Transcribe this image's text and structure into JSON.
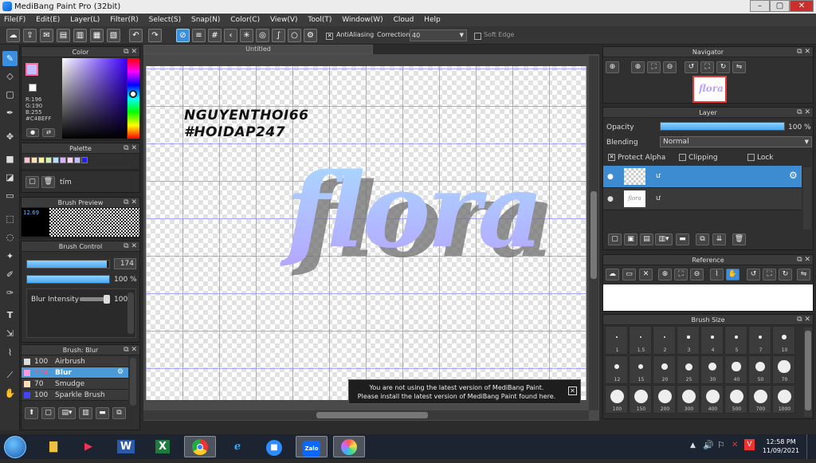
{
  "window": {
    "title": "MediBang Paint Pro (32bit)",
    "min": "–",
    "max": "▢",
    "close": "✕"
  },
  "menu": [
    "File(F)",
    "Edit(E)",
    "Layer(L)",
    "Filter(R)",
    "Select(S)",
    "Snap(N)",
    "Color(C)",
    "View(V)",
    "Tool(T)",
    "Window(W)",
    "Cloud",
    "Help"
  ],
  "toolbar": {
    "antialiasing_label": "AntiAliasing",
    "antialiasing_checked": true,
    "correction_label": "Correction",
    "correction_value": "40",
    "softedge_label": "Soft Edge",
    "softedge_checked": false
  },
  "color_panel": {
    "title": "Color",
    "r": "R:196",
    "g": "G:190",
    "b": "B:255",
    "hex": "#C4BEFF",
    "main_color": "#C4BEFF"
  },
  "palette": {
    "title": "Palette",
    "name": "tím",
    "swatches": [
      "#ffc0d0",
      "#ffe0b0",
      "#fff0a0",
      "#d0f0b0",
      "#b0e0ff",
      "#e0b0ff",
      "#ffd0f0",
      "#c4beff",
      "#2020ff"
    ]
  },
  "brush_preview": {
    "title": "Brush Preview",
    "size": "12.69"
  },
  "brush_control": {
    "title": "Brush Control",
    "size_value": "174",
    "size_fraction": 0.97,
    "opacity_value": "100 %",
    "opacity_fraction": 1.0,
    "blur_label": "Blur Intensity",
    "blur_value": "100"
  },
  "brush_list": {
    "title": "Brush: Blur",
    "items": [
      {
        "size": "100",
        "name": "Airbrush",
        "color": "#dddddd"
      },
      {
        "size": "174",
        "name": "Blur",
        "color": "#ff99dd",
        "selected": true
      },
      {
        "size": "70",
        "name": "Smudge",
        "color": "#ffddbb"
      },
      {
        "size": "100",
        "name": "Sparkle Brush",
        "color": "#4444ff"
      }
    ]
  },
  "canvas": {
    "tab": "Untitled",
    "watermark_line1": "NGUYENTHOI66",
    "watermark_line2": "#HOIDAP247",
    "art_text": "flora"
  },
  "notification": {
    "line1": "You are not using the latest version of MediBang Paint.",
    "line2": "Please install the latest version of MediBang Paint found here.",
    "close": "✕"
  },
  "navigator": {
    "title": "Navigator",
    "thumb_text": "flora"
  },
  "layer_panel": {
    "title": "Layer",
    "opacity_label": "Opacity",
    "opacity_value": "100 %",
    "opacity_fraction": 1.0,
    "blending_label": "Blending",
    "blending_value": "Normal",
    "protect_alpha": "Protect Alpha",
    "protect_alpha_checked": true,
    "clipping": "Clipping",
    "clipping_checked": false,
    "lock": "Lock",
    "lock_checked": false,
    "layers": [
      {
        "name": "ư",
        "selected": true
      },
      {
        "name": "ư",
        "selected": false
      }
    ]
  },
  "reference": {
    "title": "Reference"
  },
  "brush_size": {
    "title": "Brush Size",
    "sizes": [
      "1",
      "1.5",
      "2",
      "3",
      "4",
      "5",
      "7",
      "10",
      "12",
      "15",
      "20",
      "25",
      "30",
      "40",
      "50",
      "70",
      "100",
      "150",
      "200",
      "300",
      "400",
      "500",
      "700",
      "1000"
    ]
  },
  "taskbar": {
    "apps": [
      "start",
      "explorer",
      "media-player",
      "word",
      "excel",
      "chrome",
      "ie",
      "zoom",
      "zalo",
      "medibang"
    ],
    "zalo_label": "Zalo",
    "word_label": "W",
    "excel_label": "X",
    "time": "12:58 PM",
    "date": "11/09/2021"
  }
}
